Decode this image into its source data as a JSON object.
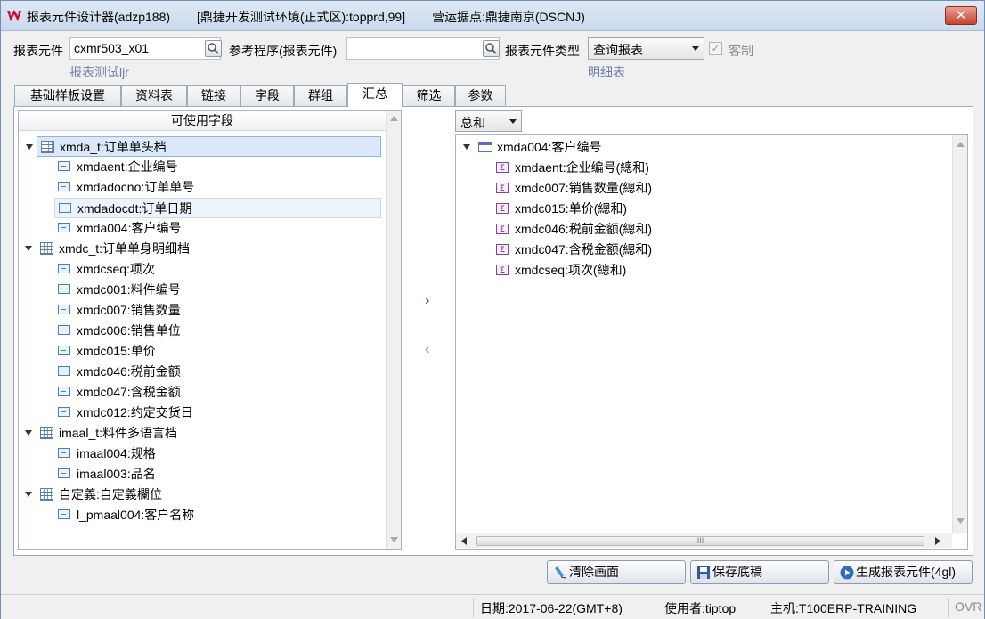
{
  "window": {
    "title_parts": [
      "报表元件设计器(adzp188)",
      "[鼎捷开发测试环境(正式区):topprd,99]",
      "营运据点:鼎捷南京(DSCNJ)"
    ],
    "close_label": "✕"
  },
  "form": {
    "element_label": "报表元件",
    "element_value": "cxmr503_x01",
    "element_desc": "报表测试ljr",
    "ref_program_label": "参考程序(报表元件)",
    "ref_program_value": "",
    "element_type_label": "报表元件类型",
    "element_type_value": "查询报表",
    "element_type_desc": "明细表",
    "custom_label": "客制",
    "custom_checked": true
  },
  "tabs": [
    {
      "label": "基础样板设置",
      "active": false
    },
    {
      "label": "资料表",
      "active": false
    },
    {
      "label": "链接",
      "active": false
    },
    {
      "label": "字段",
      "active": false
    },
    {
      "label": "群组",
      "active": false
    },
    {
      "label": "汇总",
      "active": true
    },
    {
      "label": "筛选",
      "active": false
    },
    {
      "label": "参数",
      "active": false
    }
  ],
  "left_tree": {
    "header": "可使用字段",
    "nodes": [
      {
        "type": "table",
        "label": "xmda_t:订单单头档",
        "state": "selected"
      },
      {
        "type": "field",
        "label": "xmdaent:企业编号"
      },
      {
        "type": "field",
        "label": "xmdadocno:订单单号"
      },
      {
        "type": "field",
        "label": "xmdadocdt:订单日期",
        "state": "hover"
      },
      {
        "type": "field",
        "label": "xmda004:客户编号"
      },
      {
        "type": "table",
        "label": "xmdc_t:订单单身明细档"
      },
      {
        "type": "field",
        "label": "xmdcseq:项次"
      },
      {
        "type": "field",
        "label": "xmdc001:料件编号"
      },
      {
        "type": "field",
        "label": "xmdc007:销售数量"
      },
      {
        "type": "field",
        "label": "xmdc006:销售单位"
      },
      {
        "type": "field",
        "label": "xmdc015:单价"
      },
      {
        "type": "field",
        "label": "xmdc046:税前金额"
      },
      {
        "type": "field",
        "label": "xmdc047:含税金额"
      },
      {
        "type": "field",
        "label": "xmdc012:约定交货日"
      },
      {
        "type": "table",
        "label": "imaal_t:料件多语言档"
      },
      {
        "type": "field",
        "label": "imaal004:规格"
      },
      {
        "type": "field",
        "label": "imaal003:品名"
      },
      {
        "type": "table",
        "label": "自定義:自定義欄位"
      },
      {
        "type": "field",
        "label": "l_pmaal004:客户名称"
      }
    ]
  },
  "move": {
    "right": "›",
    "left": "‹"
  },
  "aggregate_select": "总和",
  "right_tree": {
    "nodes": [
      {
        "type": "group",
        "label": "xmda004:客户编号"
      },
      {
        "type": "sum",
        "label": "xmdaent:企业编号(總和)"
      },
      {
        "type": "sum",
        "label": "xmdc007:销售数量(總和)"
      },
      {
        "type": "sum",
        "label": "xmdc015:单价(總和)"
      },
      {
        "type": "sum",
        "label": "xmdc046:税前金额(總和)"
      },
      {
        "type": "sum",
        "label": "xmdc047:含税金额(總和)"
      },
      {
        "type": "sum",
        "label": "xmdcseq:项次(總和)"
      }
    ],
    "hscroll_grip": "III"
  },
  "buttons": {
    "clear": "清除画面",
    "save": "保存底稿",
    "generate": "生成报表元件(4gl)"
  },
  "status": {
    "date": "日期:2017-06-22(GMT+8)",
    "user": "使用者:tiptop",
    "host": "主机:T100ERP-TRAINING",
    "mode": "OVR"
  },
  "colors": {
    "accent": "#3f6fb5",
    "selection": "#dbe9fb",
    "sublabel": "#6a7fa6"
  }
}
